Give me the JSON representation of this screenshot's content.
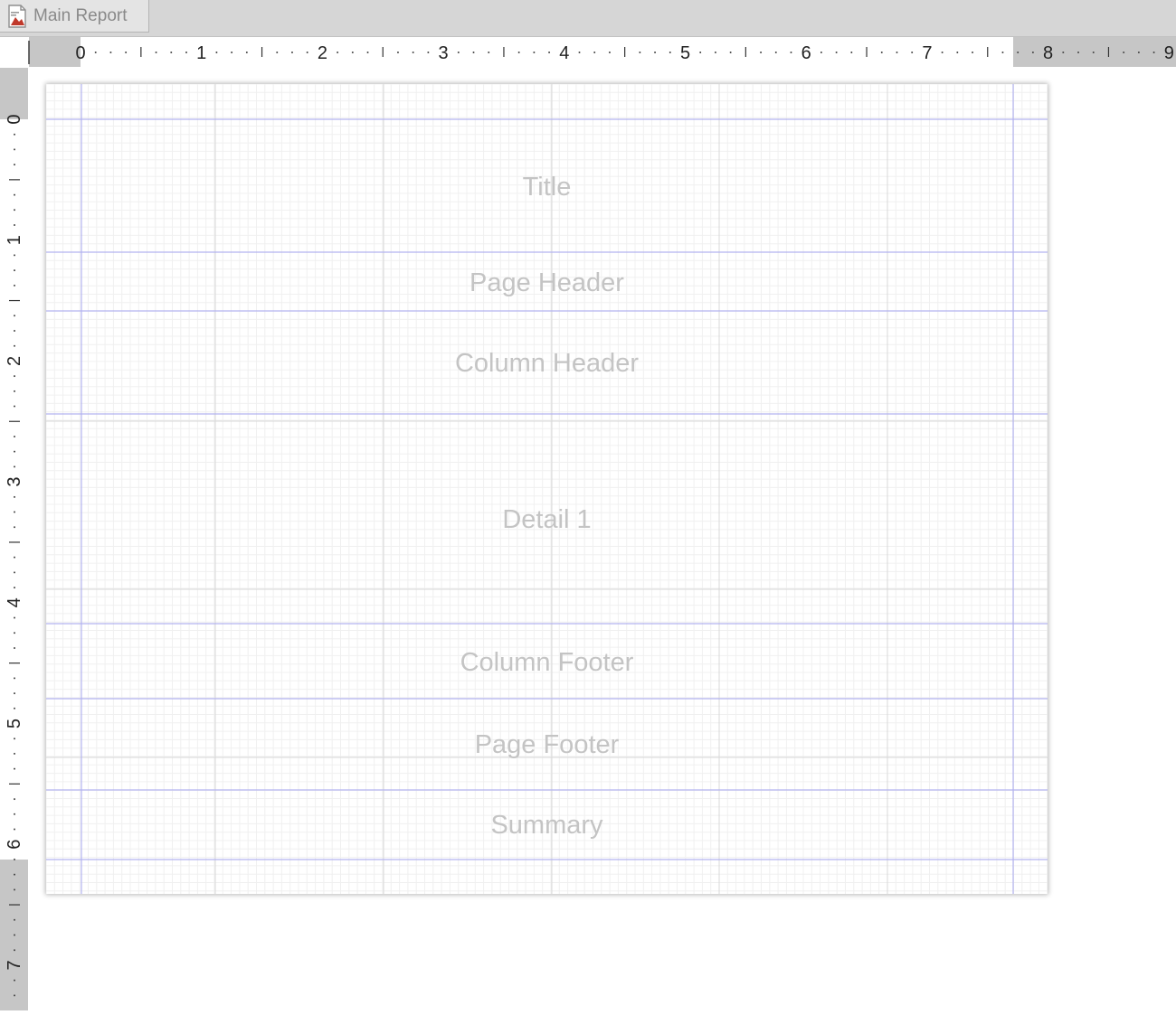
{
  "tab": {
    "label": "Main Report",
    "icon": "report-icon"
  },
  "rulers": {
    "horizontal_labels": [
      "0",
      "1",
      "2",
      "3",
      "4",
      "5",
      "6",
      "7",
      "8",
      "9"
    ],
    "vertical_labels": [
      "0",
      "1",
      "2",
      "3",
      "4",
      "5",
      "6",
      "7"
    ],
    "unit": "inch"
  },
  "bands": [
    {
      "label": "Title"
    },
    {
      "label": "Page Header"
    },
    {
      "label": "Column Header"
    },
    {
      "label": "Detail 1"
    },
    {
      "label": "Column Footer"
    },
    {
      "label": "Page Footer"
    },
    {
      "label": "Summary"
    }
  ],
  "colors": {
    "band_line": "#b3b3f0",
    "grid_minor": "#f0f0f0",
    "grid_major": "#d9d9d9",
    "band_text": "#c4c4c4",
    "ruler_gray": "#c6c6c6"
  }
}
